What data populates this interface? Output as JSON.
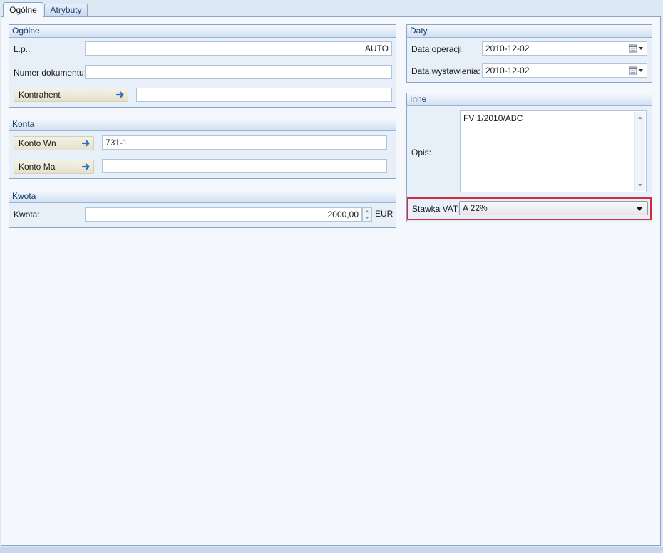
{
  "tabs": [
    {
      "label": "Ogólne",
      "active": true
    },
    {
      "label": "Atrybuty",
      "active": false
    }
  ],
  "groups": {
    "ogolne": {
      "title": "Ogólne",
      "lp_label": "L.p.:",
      "lp_value": "AUTO",
      "numer_label": "Numer dokumentu:",
      "numer_value": "",
      "kontrahent_label": "Kontrahent",
      "kontrahent_value": ""
    },
    "konta": {
      "title": "Konta",
      "konto_wn_label": "Konto Wn",
      "konto_wn_value": "731-1",
      "konto_ma_label": "Konto Ma",
      "konto_ma_value": ""
    },
    "kwota": {
      "title": "Kwota",
      "kwota_label": "Kwota:",
      "kwota_value": "2000,00",
      "currency": "EUR"
    },
    "daty": {
      "title": "Daty",
      "data_operacji_label": "Data operacji:",
      "data_operacji_value": "2010-12-02",
      "data_wystawienia_label": "Data wystawienia:",
      "data_wystawienia_value": "2010-12-02"
    },
    "inne": {
      "title": "Inne",
      "opis_label": "Opis:",
      "opis_value": "FV 1/2010/ABC",
      "vat_label": "Stawka VAT:",
      "vat_value": "A 22%"
    }
  },
  "colors": {
    "accent_border": "#8ba3c4",
    "highlight": "#d22b3e",
    "link_arrow": "#2b6fc0"
  }
}
